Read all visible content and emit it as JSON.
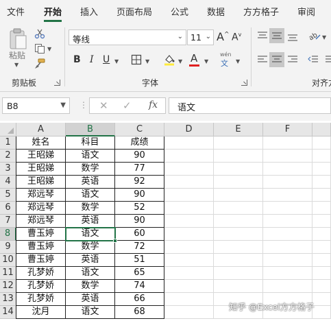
{
  "tabs": [
    "文件",
    "开始",
    "插入",
    "页面布局",
    "公式",
    "数据",
    "方方格子",
    "审阅"
  ],
  "active_tab_index": 1,
  "clipboard": {
    "paste_label": "粘贴",
    "group_label": "剪贴板",
    "icons": [
      "paste-icon",
      "cut-icon",
      "copy-icon",
      "format-painter-icon"
    ]
  },
  "font": {
    "name": "等线",
    "size": "11",
    "grow_label": "A",
    "shrink_label": "A",
    "bold": "B",
    "italic": "I",
    "underline": "U",
    "font_color_letter": "A",
    "phonetic_top": "wén",
    "phonetic_bottom": "文",
    "group_label": "字体",
    "font_color": "#e02020",
    "highlight_color": "#ffeb3b"
  },
  "alignment": {
    "group_label": "对齐方式"
  },
  "formula_bar": {
    "name_box": "B8",
    "cancel": "✕",
    "confirm": "✓",
    "fx": "fx",
    "formula": "语文"
  },
  "sheet": {
    "columns": [
      "A",
      "B",
      "C",
      "D",
      "E",
      "F"
    ],
    "rows": [
      "1",
      "2",
      "3",
      "4",
      "5",
      "6",
      "7",
      "8",
      "9",
      "10",
      "11",
      "12",
      "13",
      "14"
    ],
    "selected_cell": "B8",
    "data": [
      [
        "姓名",
        "科目",
        "成绩"
      ],
      [
        "王昭娣",
        "语文",
        "90"
      ],
      [
        "王昭娣",
        "数学",
        "77"
      ],
      [
        "王昭娣",
        "英语",
        "92"
      ],
      [
        "郑远琴",
        "语文",
        "90"
      ],
      [
        "郑远琴",
        "数学",
        "52"
      ],
      [
        "郑远琴",
        "英语",
        "90"
      ],
      [
        "曹玉婷",
        "语文",
        "60"
      ],
      [
        "曹玉婷",
        "数学",
        "72"
      ],
      [
        "曹玉婷",
        "英语",
        "51"
      ],
      [
        "孔梦娇",
        "语文",
        "65"
      ],
      [
        "孔梦娇",
        "数学",
        "74"
      ],
      [
        "孔梦娇",
        "英语",
        "66"
      ],
      [
        "沈月",
        "语文",
        "68"
      ]
    ]
  },
  "watermark": "知乎 @Excel方方格子",
  "colors": {
    "accent": "#217346",
    "ribbon_bg": "#f3f3f3",
    "header_bg": "#e6e6e6"
  }
}
